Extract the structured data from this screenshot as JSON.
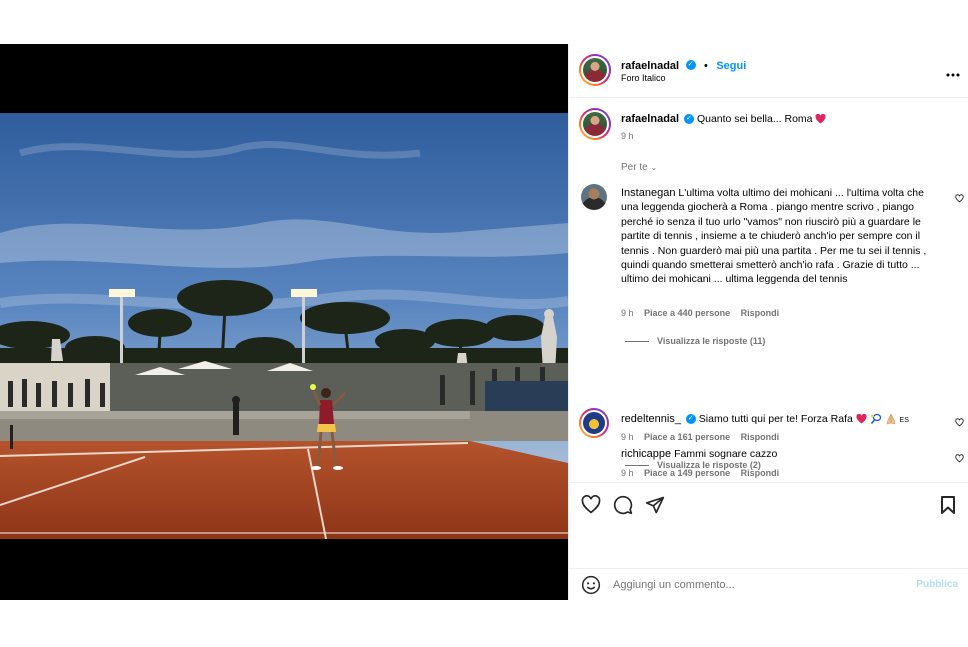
{
  "post": {
    "author": {
      "username": "rafaelnadal",
      "verified_icon": "verified-badge-icon",
      "follow_label": "Segui",
      "location": "Foro Italico",
      "more_icon": "more-options-icon"
    },
    "caption": {
      "username": "rafaelnadal",
      "text": "Quanto sei bella... Roma",
      "emoji": "red-heart-emoji",
      "time": "9 h"
    },
    "filter_label": "Per te",
    "comments": [
      {
        "username": "Instanegan",
        "text": "L'ultima volta ultimo dei mohicani ... l'ultima volta che una leggenda giocherà a Roma . piango mentre scrivo , piango perché io senza il tuo urlo \"vamos\" non riuscirò più a guardare le partite di tennis , insieme a te chiuderò anch'io per sempre con il tennis . Non guarderò mai più una partita . Per me tu sei il tennis , quindi quando smetterai smetterò anch'io rafa . Grazie di tutto ... ultimo dei mohicani ... ultima leggenda del tennis",
        "time": "9 h",
        "likes": "Piace a 440 persone",
        "reply": "Rispondi",
        "view_replies": "Visualizza le risposte (11)"
      },
      {
        "username": "redeltennis_",
        "text": "Siamo tutti qui per te! Forza Rafa",
        "emoji_suffix": "ES",
        "time": "9 h",
        "likes": "Piace a 161 persone",
        "reply": "Rispondi",
        "view_replies": "Visualizza le risposte (2)"
      },
      {
        "username": "richicappe",
        "text": "Fammi sognare cazzo",
        "time": "9 h",
        "likes": "Piace a 149 persone",
        "reply": "Rispondi"
      }
    ],
    "add_comment_placeholder": "Aggiungi un commento...",
    "publish_label": "Pubblica",
    "colors": {
      "accent": "#0095f6",
      "heart_red": "#e0245e",
      "text_secondary": "#737373",
      "divider": "#efefef",
      "clay": "#a3411f",
      "sky": "#4b7ab7"
    }
  }
}
